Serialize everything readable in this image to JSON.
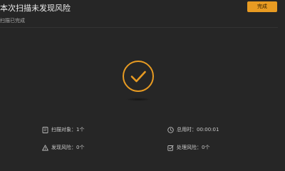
{
  "header": {
    "title": "本次扫描未发现风险",
    "subtitle": "扫描已完成",
    "done_label": "完成"
  },
  "colors": {
    "accent": "#e89b22",
    "background": "#262626"
  },
  "result": {
    "icon": "check-circle-icon"
  },
  "stats": {
    "scanned": {
      "icon": "document-icon",
      "label": "扫描对象：1个"
    },
    "elapsed": {
      "icon": "clock-icon",
      "label": "总用时：00:00:01"
    },
    "found": {
      "icon": "warning-icon",
      "label": "发现风险：0个"
    },
    "handled": {
      "icon": "edit-icon",
      "label": "处理风险：0个"
    }
  }
}
